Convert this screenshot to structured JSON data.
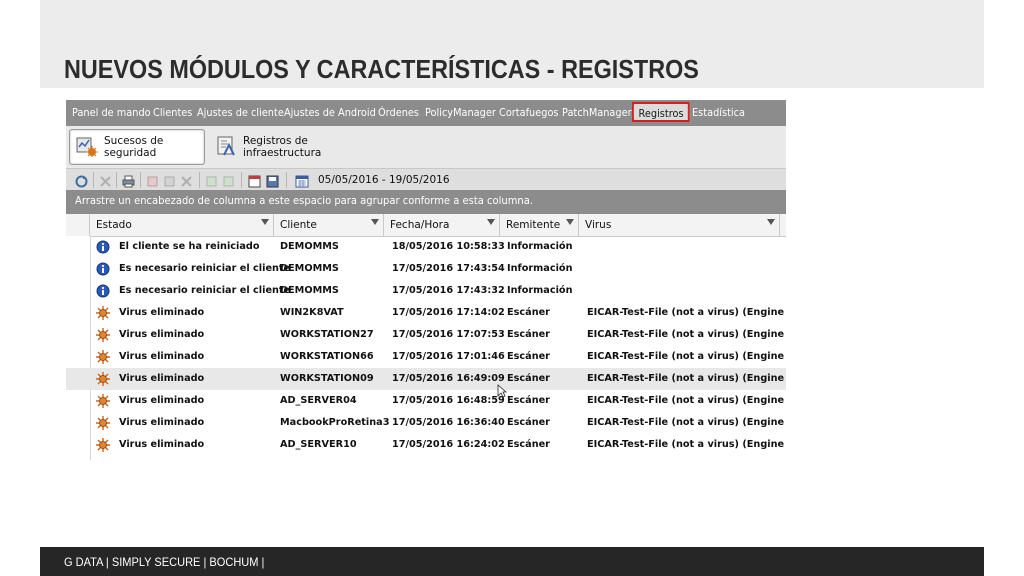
{
  "slide": {
    "title": "NUEVOS MÓDULOS Y CARACTERÍSTICAS - REGISTROS",
    "footer": "G DATA | SIMPLY SECURE | BOCHUM |"
  },
  "menu": {
    "items": [
      "Panel de mando",
      "Clientes",
      "Ajustes de cliente",
      "Ajustes de Android",
      "Órdenes",
      "PolicyManager",
      "Cortafuegos",
      "PatchManager",
      "Registros",
      "Estadística"
    ],
    "active": "Registros"
  },
  "ribbon": {
    "security_events": "Sucesos de seguridad",
    "infrastructure_logs": "Registros de infraestructura"
  },
  "toolbar": {
    "date_range": "05/05/2016 - 19/05/2016"
  },
  "grouping_hint": "Arrastre un encabezado de columna a este espacio para agrupar conforme a esta columna.",
  "table": {
    "columns": [
      "Estado",
      "Cliente",
      "Fecha/Hora",
      "Remitente",
      "Virus"
    ],
    "rows": [
      {
        "icon": "info-icon",
        "estado": "El cliente se ha reiniciado",
        "cliente": "DEMOMMS",
        "fecha": "18/05/2016 10:58:33",
        "remitente": "Información",
        "virus": ""
      },
      {
        "icon": "info-icon",
        "estado": "Es necesario reiniciar el cliente",
        "cliente": "DEMOMMS",
        "fecha": "17/05/2016 17:43:54",
        "remitente": "Información",
        "virus": ""
      },
      {
        "icon": "info-icon",
        "estado": "Es necesario reiniciar el cliente",
        "cliente": "DEMOMMS",
        "fecha": "17/05/2016 17:43:32",
        "remitente": "Información",
        "virus": ""
      },
      {
        "icon": "virus-icon",
        "estado": "Virus eliminado",
        "cliente": "WIN2K8VAT",
        "fecha": "17/05/2016 17:14:02",
        "remitente": "Escáner",
        "virus": "EICAR-Test-File (not a virus) (Engine A)"
      },
      {
        "icon": "virus-icon",
        "estado": "Virus eliminado",
        "cliente": "WORKSTATION27",
        "fecha": "17/05/2016 17:07:53",
        "remitente": "Escáner",
        "virus": "EICAR-Test-File (not a virus) (Engine A)"
      },
      {
        "icon": "virus-icon",
        "estado": "Virus eliminado",
        "cliente": "WORKSTATION66",
        "fecha": "17/05/2016 17:01:46",
        "remitente": "Escáner",
        "virus": "EICAR-Test-File (not a virus) (Engine A)"
      },
      {
        "icon": "virus-icon",
        "estado": "Virus eliminado",
        "cliente": "WORKSTATION09",
        "fecha": "17/05/2016 16:49:09",
        "remitente": "Escáner",
        "virus": "EICAR-Test-File (not a virus) (Engine A)"
      },
      {
        "icon": "virus-icon",
        "estado": "Virus eliminado",
        "cliente": "AD_SERVER04",
        "fecha": "17/05/2016 16:48:59",
        "remitente": "Escáner",
        "virus": "EICAR-Test-File (not a virus) (Engine A)"
      },
      {
        "icon": "virus-icon",
        "estado": "Virus eliminado",
        "cliente": "MacbookProRetina3",
        "fecha": "17/05/2016 16:36:40",
        "remitente": "Escáner",
        "virus": "EICAR-Test-File (not a virus) (Engine A)"
      },
      {
        "icon": "virus-icon",
        "estado": "Virus eliminado",
        "cliente": "AD_SERVER10",
        "fecha": "17/05/2016 16:24:02",
        "remitente": "Escáner",
        "virus": "EICAR-Test-File (not a virus) (Engine A)"
      }
    ],
    "highlighted_row": 6
  },
  "colors": {
    "menu_bg": "#8c8c8c",
    "active_outline": "#d81e1e",
    "footer_bg": "#262626",
    "info_icon": "#2a5ab8",
    "virus_icon": "#c8641e"
  }
}
